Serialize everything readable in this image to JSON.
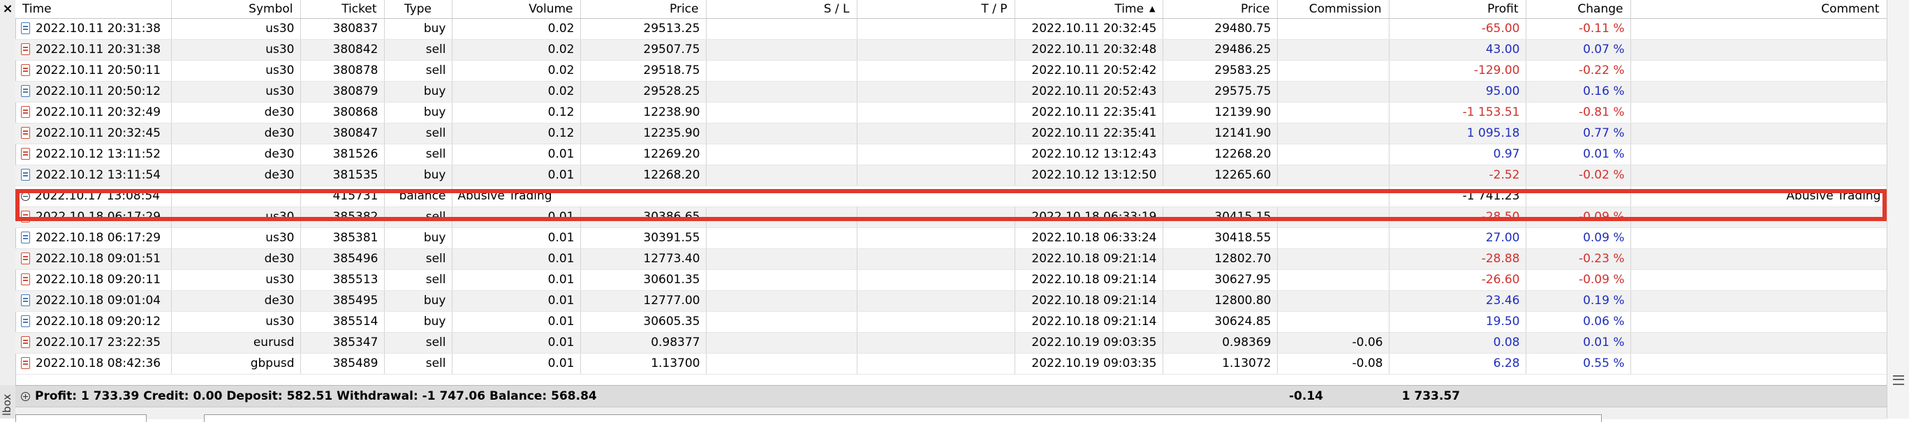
{
  "columns": [
    "Time",
    "Symbol",
    "Ticket",
    "Type",
    "Volume",
    "Price",
    "S / L",
    "T / P",
    "Time",
    "Price",
    "Commission",
    "Profit",
    "Change",
    "Comment"
  ],
  "sort_indicator": "▲",
  "rows_before": [
    {
      "dir": "buy",
      "open": "2022.10.11 20:31:38",
      "symbol": "us30",
      "ticket": "380837",
      "type": "buy",
      "volume": "0.02",
      "price": "29513.25",
      "close": "2022.10.11 20:32:45",
      "cprice": "29480.75",
      "commission": "",
      "profit": "-65.00",
      "change": "-0.11 %"
    },
    {
      "dir": "sell",
      "open": "2022.10.11 20:31:38",
      "symbol": "us30",
      "ticket": "380842",
      "type": "sell",
      "volume": "0.02",
      "price": "29507.75",
      "close": "2022.10.11 20:32:48",
      "cprice": "29486.25",
      "commission": "",
      "profit": "43.00",
      "change": "0.07 %"
    },
    {
      "dir": "sell",
      "open": "2022.10.11 20:50:11",
      "symbol": "us30",
      "ticket": "380878",
      "type": "sell",
      "volume": "0.02",
      "price": "29518.75",
      "close": "2022.10.11 20:52:42",
      "cprice": "29583.25",
      "commission": "",
      "profit": "-129.00",
      "change": "-0.22 %"
    },
    {
      "dir": "buy",
      "open": "2022.10.11 20:50:12",
      "symbol": "us30",
      "ticket": "380879",
      "type": "buy",
      "volume": "0.02",
      "price": "29528.25",
      "close": "2022.10.11 20:52:43",
      "cprice": "29575.75",
      "commission": "",
      "profit": "95.00",
      "change": "0.16 %"
    },
    {
      "dir": "sell",
      "open": "2022.10.11 20:32:49",
      "symbol": "de30",
      "ticket": "380868",
      "type": "buy",
      "volume": "0.12",
      "price": "12238.90",
      "close": "2022.10.11 22:35:41",
      "cprice": "12139.90",
      "commission": "",
      "profit": "-1 153.51",
      "change": "-0.81 %"
    },
    {
      "dir": "sell",
      "open": "2022.10.11 20:32:45",
      "symbol": "de30",
      "ticket": "380847",
      "type": "sell",
      "volume": "0.12",
      "price": "12235.90",
      "close": "2022.10.11 22:35:41",
      "cprice": "12141.90",
      "commission": "",
      "profit": "1 095.18",
      "change": "0.77 %"
    },
    {
      "dir": "sell",
      "open": "2022.10.12 13:11:52",
      "symbol": "de30",
      "ticket": "381526",
      "type": "sell",
      "volume": "0.01",
      "price": "12269.20",
      "close": "2022.10.12 13:12:43",
      "cprice": "12268.20",
      "commission": "",
      "profit": "0.97",
      "change": "0.01 %"
    },
    {
      "dir": "buy",
      "open": "2022.10.12 13:11:54",
      "symbol": "de30",
      "ticket": "381535",
      "type": "buy",
      "volume": "0.01",
      "price": "12268.20",
      "close": "2022.10.12 13:12:50",
      "cprice": "12265.60",
      "commission": "",
      "profit": "-2.52",
      "change": "-0.02 %"
    }
  ],
  "balance_row": {
    "time": "2022.10.17 13:08:54",
    "ticket": "415731",
    "type": "balance",
    "description": "Abusive Trading",
    "profit": "-1 741.23",
    "comment": "Abusive Trading"
  },
  "rows_after": [
    {
      "dir": "sell",
      "open": "2022.10.18 06:17:29",
      "symbol": "us30",
      "ticket": "385382",
      "type": "sell",
      "volume": "0.01",
      "price": "30386.65",
      "close": "2022.10.18 06:33:19",
      "cprice": "30415.15",
      "commission": "",
      "profit": "-28.50",
      "change": "-0.09 %"
    },
    {
      "dir": "buy",
      "open": "2022.10.18 06:17:29",
      "symbol": "us30",
      "ticket": "385381",
      "type": "buy",
      "volume": "0.01",
      "price": "30391.55",
      "close": "2022.10.18 06:33:24",
      "cprice": "30418.55",
      "commission": "",
      "profit": "27.00",
      "change": "0.09 %"
    },
    {
      "dir": "sell",
      "open": "2022.10.18 09:01:51",
      "symbol": "de30",
      "ticket": "385496",
      "type": "sell",
      "volume": "0.01",
      "price": "12773.40",
      "close": "2022.10.18 09:21:14",
      "cprice": "12802.70",
      "commission": "",
      "profit": "-28.88",
      "change": "-0.23 %"
    },
    {
      "dir": "sell",
      "open": "2022.10.18 09:20:11",
      "symbol": "us30",
      "ticket": "385513",
      "type": "sell",
      "volume": "0.01",
      "price": "30601.35",
      "close": "2022.10.18 09:21:14",
      "cprice": "30627.95",
      "commission": "",
      "profit": "-26.60",
      "change": "-0.09 %"
    },
    {
      "dir": "buy",
      "open": "2022.10.18 09:01:04",
      "symbol": "de30",
      "ticket": "385495",
      "type": "buy",
      "volume": "0.01",
      "price": "12777.00",
      "close": "2022.10.18 09:21:14",
      "cprice": "12800.80",
      "commission": "",
      "profit": "23.46",
      "change": "0.19 %"
    },
    {
      "dir": "buy",
      "open": "2022.10.18 09:20:12",
      "symbol": "us30",
      "ticket": "385514",
      "type": "buy",
      "volume": "0.01",
      "price": "30605.35",
      "close": "2022.10.18 09:21:14",
      "cprice": "30624.85",
      "commission": "",
      "profit": "19.50",
      "change": "0.06 %"
    },
    {
      "dir": "sell",
      "open": "2022.10.17 23:22:35",
      "symbol": "eurusd",
      "ticket": "385347",
      "type": "sell",
      "volume": "0.01",
      "price": "0.98377",
      "close": "2022.10.19 09:03:35",
      "cprice": "0.98369",
      "commission": "-0.06",
      "profit": "0.08",
      "change": "0.01 %"
    },
    {
      "dir": "sell",
      "open": "2022.10.18 08:42:36",
      "symbol": "gbpusd",
      "ticket": "385489",
      "type": "sell",
      "volume": "0.01",
      "price": "1.13700",
      "close": "2022.10.19 09:03:35",
      "cprice": "1.13072",
      "commission": "-0.08",
      "profit": "6.28",
      "change": "0.55 %"
    }
  ],
  "summary": {
    "text": "Profit: 1 733.39  Credit: 0.00  Deposit: 582.51  Withdrawal: -1 747.06  Balance: 568.84",
    "commission": "-0.14",
    "profit": "1 733.57"
  },
  "toolbox_label": "lbox",
  "close_glyph": "×",
  "colors": {
    "negative": "#d0312d",
    "positive": "#1f2dbd",
    "highlight": "#e2382b"
  }
}
